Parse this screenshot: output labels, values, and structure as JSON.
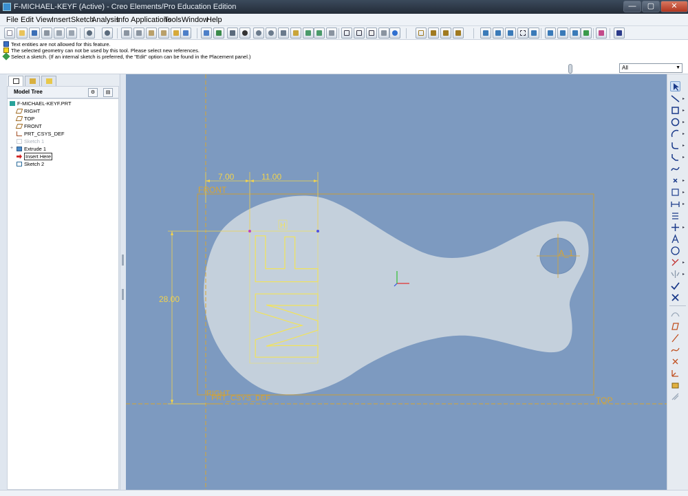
{
  "window": {
    "title": "F-MICHAEL-KEYF (Active) - Creo Elements/Pro Education Edition",
    "controls": [
      "—",
      "▢",
      "✕"
    ]
  },
  "menu": [
    "File",
    "Edit",
    "View",
    "Insert",
    "Sketch",
    "Analysis",
    "Info",
    "Applications",
    "Tools",
    "Window",
    "Help"
  ],
  "messages": [
    {
      "icon": "text-note-icon",
      "text": "Text entities are not allowed for this feature."
    },
    {
      "icon": "warning-icon",
      "text": "The selected geometry can not be used by this tool. Please select new references."
    },
    {
      "icon": "prompt-icon",
      "text": "Select a sketch. (If an internal sketch is preferred, the \"Edit\" option can be found in the Placement panel.)"
    }
  ],
  "filter": {
    "value": "All"
  },
  "model_tree": {
    "header": "Model Tree",
    "items": [
      {
        "label": "F-MICHAEL-KEYF.PRT",
        "icon": "part-icon",
        "state": "normal"
      },
      {
        "label": "RIGHT",
        "icon": "datum-plane-icon",
        "state": "normal"
      },
      {
        "label": "TOP",
        "icon": "datum-plane-icon",
        "state": "normal"
      },
      {
        "label": "FRONT",
        "icon": "datum-plane-icon",
        "state": "normal"
      },
      {
        "label": "PRT_CSYS_DEF",
        "icon": "csys-icon",
        "state": "normal"
      },
      {
        "label": "Sketch 1",
        "icon": "sketch-icon",
        "state": "dim"
      },
      {
        "label": "Extrude 1",
        "icon": "extrude-icon",
        "state": "normal"
      },
      {
        "label": "Insert Here",
        "icon": "insert-arrow-icon",
        "state": "insert"
      },
      {
        "label": "Sketch 2",
        "icon": "sketch-icon",
        "state": "normal"
      }
    ]
  },
  "sketch": {
    "dimensions": {
      "d1": "7.00",
      "d2": "11.00",
      "d3": "28.00"
    },
    "datum_labels": {
      "front": "FRONT",
      "right": "RIGHT",
      "csys": "PRT_CSYS_DEF",
      "top": "TOP",
      "axis": "A_1"
    },
    "constraint_label": "H",
    "text_entity": "MF"
  },
  "colors": {
    "graphics_bg": "#7d9ac0",
    "part_fill": "#c4d0dc",
    "sketch_yellow": "#f2e35a",
    "datum_orange": "#d8a531",
    "dimension_color": "#f2d34c"
  }
}
